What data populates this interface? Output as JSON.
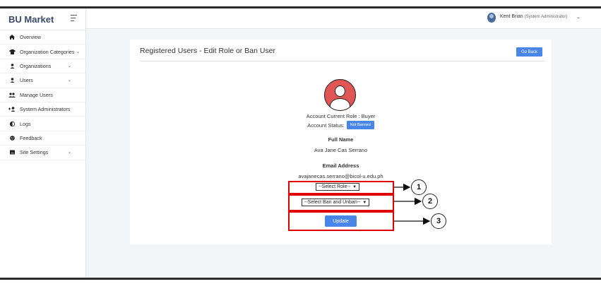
{
  "brand": {
    "name": "BU Market"
  },
  "sidebar": {
    "items": [
      {
        "label": "Overview",
        "icon": "home-icon",
        "glyph": "⌂",
        "has_chevron": false
      },
      {
        "label": "Organization Categories",
        "icon": "shirt-icon",
        "glyph": "👕",
        "has_chevron": true
      },
      {
        "label": "Organizations",
        "icon": "user-icon",
        "glyph": "●",
        "has_chevron": true
      },
      {
        "label": "Users",
        "icon": "user-icon",
        "glyph": "●",
        "has_chevron": true
      },
      {
        "label": "Manage Users",
        "icon": "users-group-icon",
        "glyph": "●●",
        "has_chevron": false
      },
      {
        "label": "System Administrators",
        "icon": "user-plus-icon",
        "glyph": "+●",
        "has_chevron": false
      },
      {
        "label": "Logs",
        "icon": "half-circle-icon",
        "glyph": "◐",
        "has_chevron": false
      },
      {
        "label": "Feedback",
        "icon": "smiley-icon",
        "glyph": "☻",
        "has_chevron": false
      },
      {
        "label": "Site Settings",
        "icon": "image-icon",
        "glyph": "▪",
        "has_chevron": true
      }
    ]
  },
  "topbar": {
    "user_name": "Kent Brian",
    "user_role": "(System Administrator)"
  },
  "card": {
    "title": "Registered Users - Edit Role or Ban User",
    "go_back_label": "Go Back",
    "current_role_text": "Account Current Role : Buyer",
    "status_label": "Account Status:",
    "status_badge": "Not Banned",
    "full_name_label": "Full Name",
    "full_name": "Ava Jane Cas Serrano",
    "email_label": "Email Address",
    "email": "avajanecas.serrano@bicol-u.edu.ph",
    "role_select": "--Select Role--",
    "ban_select": "--Select Ban and Unban--",
    "update_label": "Update"
  },
  "callouts": [
    "1",
    "2",
    "3"
  ],
  "colors": {
    "accent": "#4a86e8",
    "highlight": "#e00000",
    "avatar": "#e25555"
  }
}
